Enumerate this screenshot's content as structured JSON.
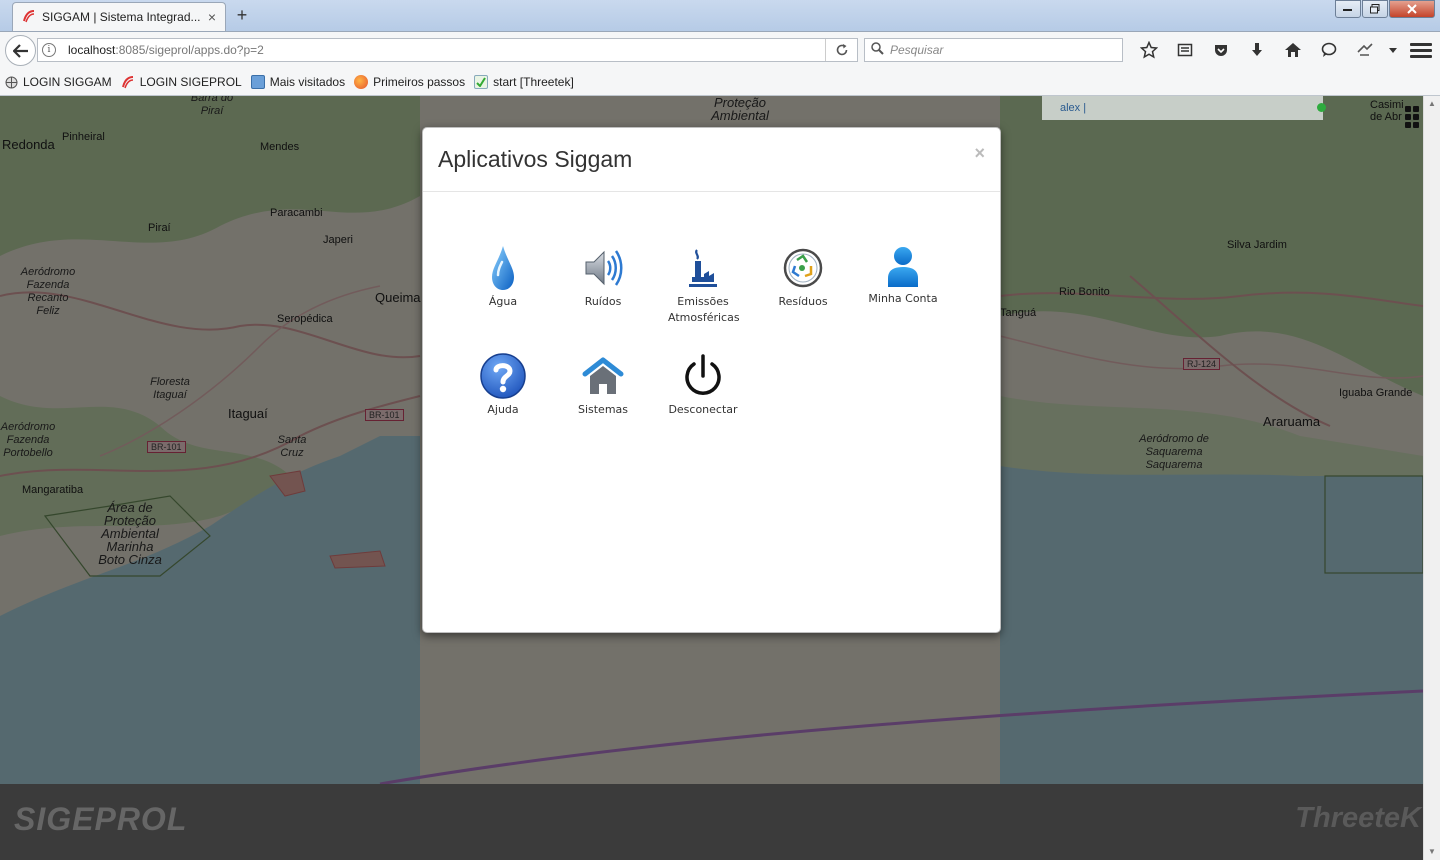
{
  "browser": {
    "tab_title": "SIGGAM | Sistema Integrad...",
    "tab_close": "×",
    "new_tab": "+",
    "url_host": "localhost",
    "url_rest": ":8085/sigeprol/apps.do?p=2",
    "search_placeholder": "Pesquisar",
    "bookmarks": [
      {
        "label": "LOGIN SIGGAM"
      },
      {
        "label": "LOGIN SIGEPROL"
      },
      {
        "label": "Mais visitados"
      },
      {
        "label": "Primeiros passos"
      },
      {
        "label": "start [Threetek]"
      }
    ]
  },
  "map": {
    "labels": {
      "redonda": "Redonda",
      "pinheiral": "Pinheiral",
      "barra_do_pirai": "Barra do Piraí",
      "mendes": "Mendes",
      "paracambi": "Paracambi",
      "pirai": "Piraí",
      "japeri": "Japeri",
      "queimados": "Queima",
      "seropedica": "Seropédica",
      "aerodromo_fazenda": "Aeródromo Fazenda Recanto Feliz",
      "floresta_itaguai": "Floresta Itaguaí",
      "itaguai": "Itaguaí",
      "santa_cruz": "Santa Cruz",
      "aerodromo_portobello": "Aeródromo Fazenda Portobello",
      "mangaratiba": "Mangaratiba",
      "area_protecao": "Área de Proteção Ambiental Marinha Boto Cinza",
      "protecao_ambiental": "Proteção Ambiental",
      "silva_jardim": "Silva Jardim",
      "rio_bonito": "Rio Bonito",
      "tangua": "Tanguá",
      "iguaba_grande": "Iguaba Grande",
      "araruama": "Araruama",
      "aerodromo_saquarema": "Aeródromo de Saquarema Saquarema",
      "casimiro": "Casimi de Abr",
      "br101_a": "BR-101",
      "br101_b": "BR-101",
      "rj124": "RJ-124"
    },
    "user": "alex  |"
  },
  "footer": {
    "logo_left": "SIGEPROL",
    "logo_right": "ThreeteK"
  },
  "modal": {
    "title": "Aplicativos Siggam",
    "close": "×",
    "apps": [
      {
        "label": "Água"
      },
      {
        "label": "Ruídos"
      },
      {
        "label": "Emissões Atmosféricas"
      },
      {
        "label": "Resíduos"
      },
      {
        "label": "Minha Conta"
      },
      {
        "label": "Ajuda"
      },
      {
        "label": "Sistemas"
      },
      {
        "label": "Desconectar"
      }
    ]
  }
}
